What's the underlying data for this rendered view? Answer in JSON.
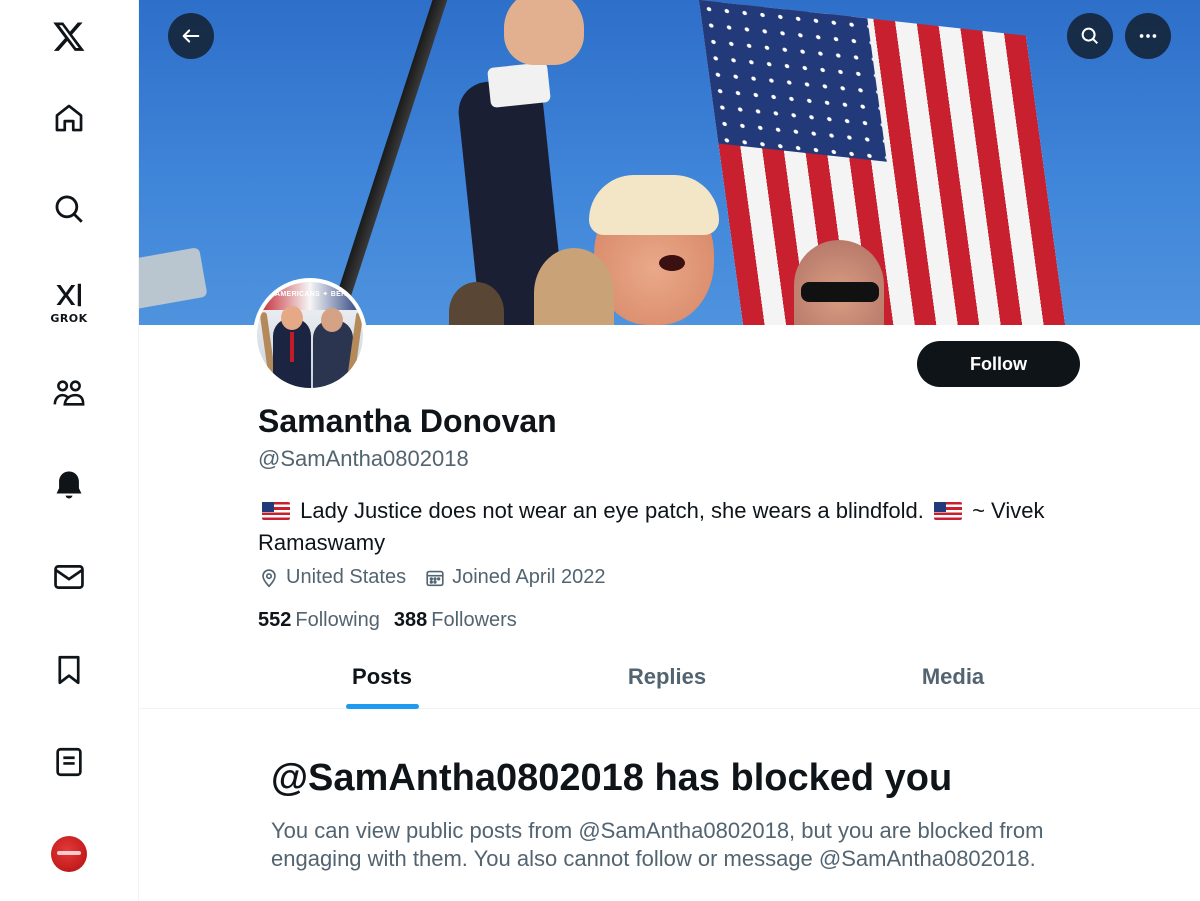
{
  "sidebar": {
    "items": [
      {
        "name": "x-logo",
        "label": ""
      },
      {
        "name": "home",
        "label": ""
      },
      {
        "name": "explore",
        "label": ""
      },
      {
        "name": "grok",
        "label": "GROK"
      },
      {
        "name": "communities",
        "label": ""
      },
      {
        "name": "notifications",
        "label": ""
      },
      {
        "name": "messages",
        "label": ""
      },
      {
        "name": "bookmarks",
        "label": ""
      },
      {
        "name": "lists",
        "label": ""
      },
      {
        "name": "profile",
        "label": ""
      }
    ],
    "grok_label": "GROK"
  },
  "profile": {
    "display_name": "Samantha Donovan",
    "handle": "@SamAntha0802018",
    "bio_part1": "Lady Justice does not wear an eye patch, she wears a blindfold.",
    "bio_part2": "~ Vivek Ramaswamy",
    "location": "United States",
    "joined": "Joined April 2022",
    "following_count": "552",
    "following_label": "Following",
    "followers_count": "388",
    "followers_label": "Followers",
    "follow_button": "Follow",
    "avatar_sign_text": "AMERICANS ✦ BERN"
  },
  "tabs": [
    {
      "label": "Posts",
      "active": true
    },
    {
      "label": "Replies",
      "active": false
    },
    {
      "label": "Media",
      "active": false
    }
  ],
  "blocked": {
    "title": "@SamAntha0802018 has blocked you",
    "description": "You can view public posts from @SamAntha0802018, but you are blocked from engaging with them. You also cannot follow or message @SamAntha0802018."
  },
  "colors": {
    "accent": "#1d9bf0",
    "text_primary": "#0f1419",
    "text_secondary": "#536471",
    "follow_bg": "#0f1419"
  }
}
